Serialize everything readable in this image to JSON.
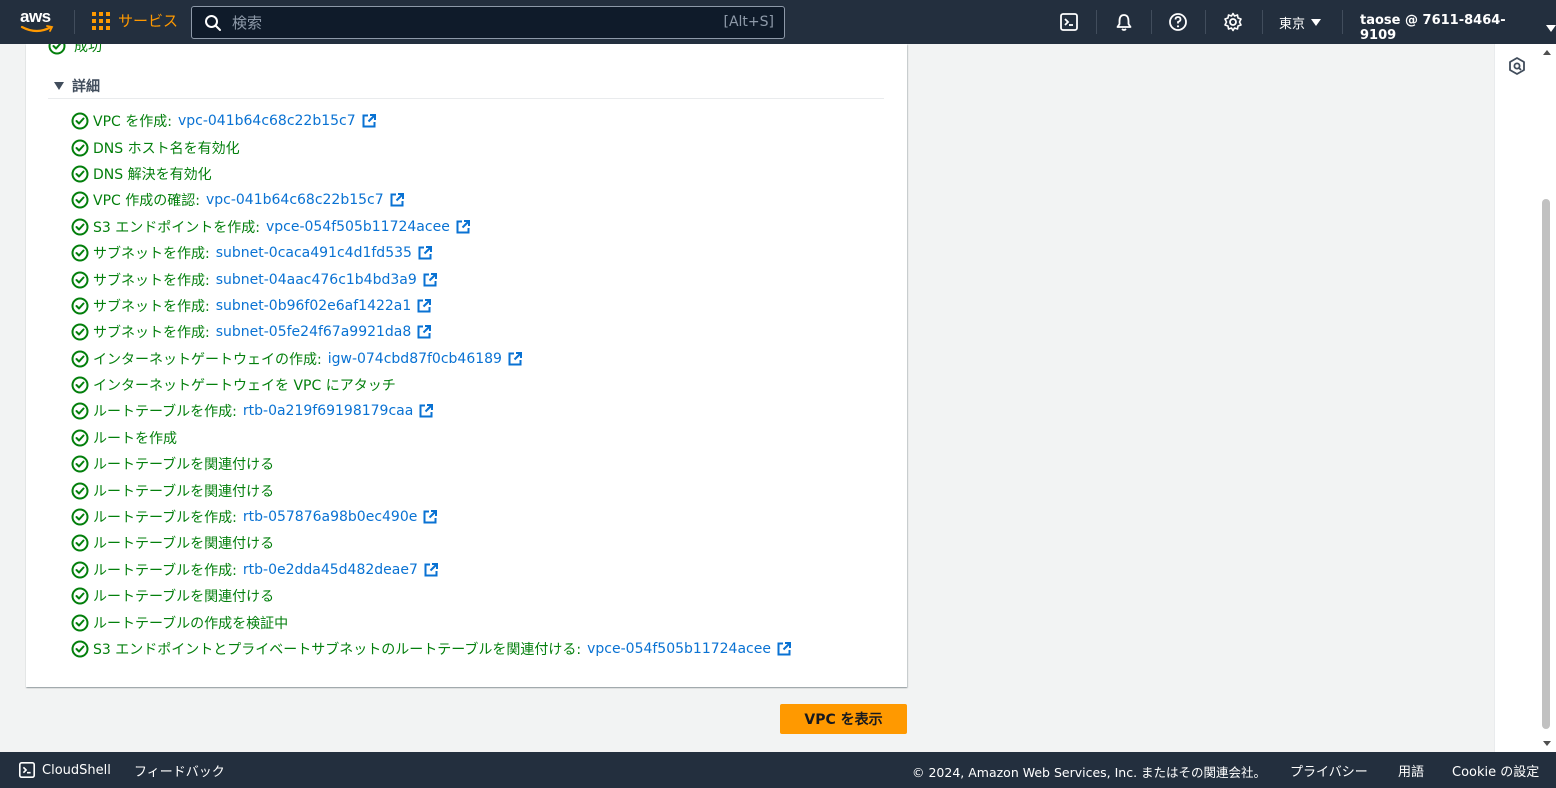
{
  "nav": {
    "logo": "aws",
    "services_label": "サービス",
    "search_placeholder": "検索",
    "search_shortcut": "[Alt+S]",
    "region": "東京",
    "account": "taose @ 7611-8464-9109"
  },
  "panel": {
    "partial_item": "成功",
    "details_label": "詳細",
    "steps": [
      {
        "text": "VPC を作成:",
        "link": "vpc-041b64c68c22b15c7"
      },
      {
        "text": "DNS ホスト名を有効化",
        "link": ""
      },
      {
        "text": "DNS 解決を有効化",
        "link": ""
      },
      {
        "text": "VPC 作成の確認:",
        "link": "vpc-041b64c68c22b15c7"
      },
      {
        "text": "S3 エンドポイントを作成:",
        "link": "vpce-054f505b11724acee"
      },
      {
        "text": "サブネットを作成:",
        "link": "subnet-0caca491c4d1fd535"
      },
      {
        "text": "サブネットを作成:",
        "link": "subnet-04aac476c1b4bd3a9"
      },
      {
        "text": "サブネットを作成:",
        "link": "subnet-0b96f02e6af1422a1"
      },
      {
        "text": "サブネットを作成:",
        "link": "subnet-05fe24f67a9921da8"
      },
      {
        "text": "インターネットゲートウェイの作成:",
        "link": "igw-074cbd87f0cb46189"
      },
      {
        "text": "インターネットゲートウェイを VPC にアタッチ",
        "link": ""
      },
      {
        "text": "ルートテーブルを作成:",
        "link": "rtb-0a219f69198179caa"
      },
      {
        "text": "ルートを作成",
        "link": ""
      },
      {
        "text": "ルートテーブルを関連付ける",
        "link": ""
      },
      {
        "text": "ルートテーブルを関連付ける",
        "link": ""
      },
      {
        "text": "ルートテーブルを作成:",
        "link": "rtb-057876a98b0ec490e"
      },
      {
        "text": "ルートテーブルを関連付ける",
        "link": ""
      },
      {
        "text": "ルートテーブルを作成:",
        "link": "rtb-0e2dda45d482deae7"
      },
      {
        "text": "ルートテーブルを関連付ける",
        "link": ""
      },
      {
        "text": "ルートテーブルの作成を検証中",
        "link": ""
      },
      {
        "text": "S3 エンドポイントとプライベートサブネットのルートテーブルを関連付ける:",
        "link": "vpce-054f505b11724acee"
      }
    ]
  },
  "primary_button": "VPC を表示",
  "footer": {
    "cloudshell": "CloudShell",
    "feedback": "フィードバック",
    "copyright": "© 2024, Amazon Web Services, Inc. またはその関連会社。",
    "privacy": "プライバシー",
    "terms": "用語",
    "cookie": "Cookie の設定"
  },
  "colors": {
    "nav_bg": "#232f3e",
    "accent": "#ff9900",
    "success": "#037f0c",
    "link": "#0972d3"
  },
  "icons": [
    "search-icon",
    "grid-icon",
    "cloudshell-icon",
    "bell-icon",
    "help-icon",
    "gear-icon",
    "check-circle-icon",
    "external-link-icon",
    "panel-icon"
  ]
}
